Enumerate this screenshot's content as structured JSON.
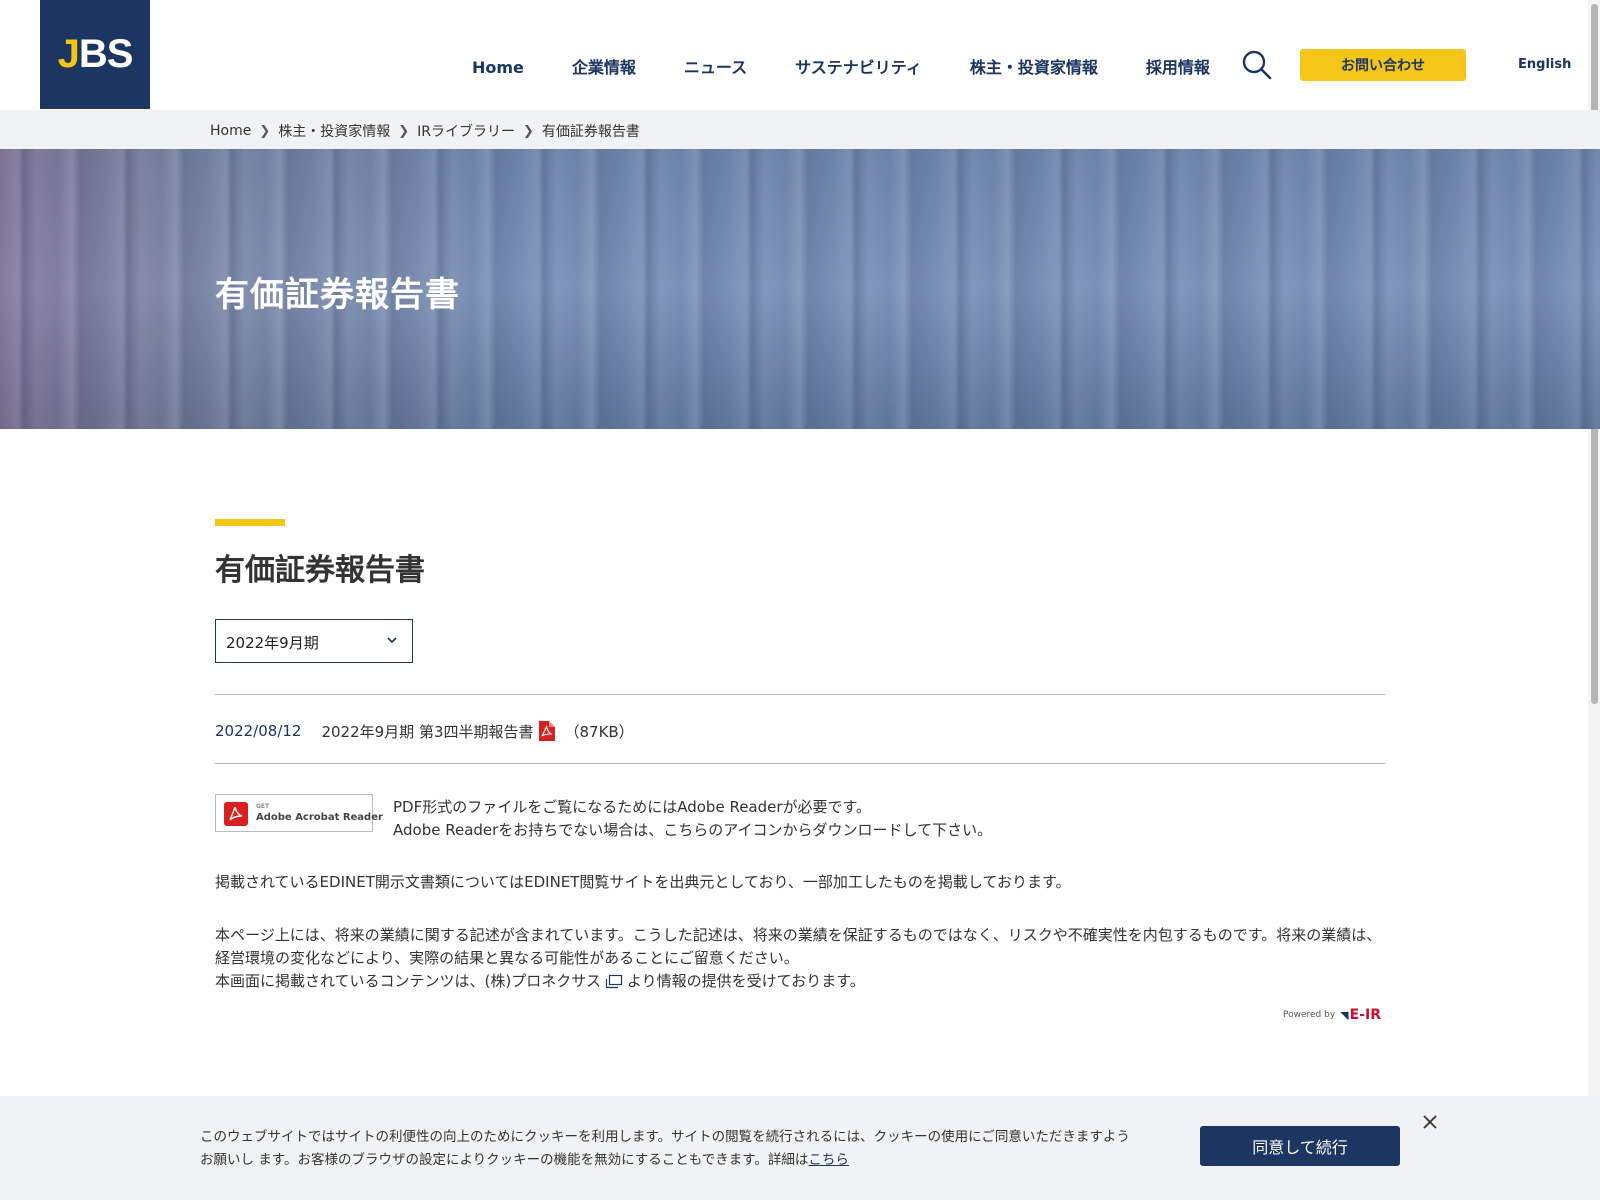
{
  "header": {
    "logo_text_j": "J",
    "logo_text_rest": "BS",
    "nav": [
      "Home",
      "企業情報",
      "ニュース",
      "サステナビリティ",
      "株主・投資家情報",
      "採用情報"
    ],
    "contact_label": "お問い合わせ",
    "language_label": "English",
    "search_icon": "search-icon"
  },
  "breadcrumb": [
    "Home",
    "株主・投資家情報",
    "IRライブラリー",
    "有価証券報告書"
  ],
  "hero": {
    "title": "有価証券報告書"
  },
  "main": {
    "page_title": "有価証券報告書",
    "period_select": {
      "value": "2022年9月期"
    },
    "report": {
      "date": "2022/08/12",
      "title": "2022年9月期 第3四半期報告書",
      "size": "（87KB）"
    },
    "acrobat": {
      "get": "GET",
      "label": "Adobe Acrobat Reader"
    },
    "pdf_note_line1": "PDF形式のファイルをご覧になるためにはAdobe Readerが必要です。",
    "pdf_note_line2": "Adobe Readerをお持ちでない場合は、こちらのアイコンからダウンロードして下さい。",
    "edinet_note": "掲載されているEDINET開示文書類についてはEDINET閲覧サイトを出典元としており、一部加工したものを掲載しております。",
    "disclaimer_line1": "本ページ上には、将来の業績に関する記述が含まれています。こうした記述は、将来の業績を保証するものではなく、リスクや不確実性を内包するものです。将来の業績は、経営環境の変化などにより、実際の結果と異なる可能性があることにご留意ください。",
    "disclaimer_line2_before": "本画面に掲載されているコンテンツは、(株)プロネクサス",
    "disclaimer_line2_after": "より情報の提供を受けております。",
    "powered_by": "Powered by",
    "powered_logo": "E-IR"
  },
  "cookie": {
    "text": "このウェブサイトではサイトの利便性の向上のためにクッキーを利用します。サイトの閲覧を続行されるには、クッキーの使用にご同意いただきますようお願いし ます。お客様のブラウザの設定によりクッキーの機能を無効にすることもできます。詳細は",
    "link": "こちら",
    "agree_button": "同意して続行"
  },
  "colors": {
    "brand_navy": "#1c3561",
    "accent_yellow": "#f5c518"
  }
}
